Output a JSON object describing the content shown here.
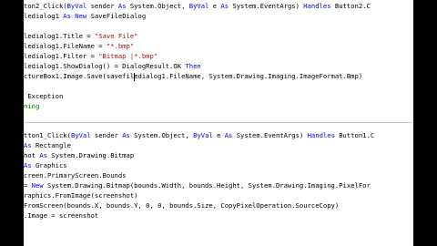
{
  "code": {
    "block1": [
      [
        [
          "ton2_Click(",
          "c"
        ],
        [
          "ByVal",
          "k"
        ],
        [
          " sender ",
          "c"
        ],
        [
          "As",
          "k"
        ],
        [
          " System.Object, ",
          "c"
        ],
        [
          "ByVal",
          "k"
        ],
        [
          " e ",
          "c"
        ],
        [
          "As",
          "k"
        ],
        [
          " System.EventArgs) ",
          "c"
        ],
        [
          "Handles",
          "k"
        ],
        [
          " Button2.C",
          "c"
        ]
      ],
      [
        [
          "ledialog1 ",
          "c"
        ],
        [
          "As New",
          "k"
        ],
        [
          " SaveFileDialog",
          "c"
        ]
      ],
      [
        [
          "",
          "c"
        ]
      ],
      [
        [
          "ledialog1.Title = ",
          "c"
        ],
        [
          "\"Save File\"",
          "s"
        ]
      ],
      [
        [
          "ledialog1.FileName = ",
          "c"
        ],
        [
          "\"*.bmp\"",
          "s"
        ]
      ],
      [
        [
          "ledialog1.Filter = ",
          "c"
        ],
        [
          "\"Bitmap |*.bmp\"",
          "s"
        ]
      ],
      [
        [
          "ledialog1.ShowDialog() = DialogResult.OK ",
          "c"
        ],
        [
          "Then",
          "k"
        ]
      ],
      [
        [
          "ctureBox1.Image.Save(savefiledialog1.FileName, System.Drawing.Imaging.ImageFormat.Bmp)",
          "c"
        ]
      ],
      [
        [
          "",
          "c"
        ]
      ],
      [
        [
          " Exception",
          "c"
        ]
      ],
      [
        [
          "ning",
          "g"
        ]
      ]
    ],
    "block2": [
      [
        [
          "tton1_Click(",
          "c"
        ],
        [
          "ByVal",
          "k"
        ],
        [
          " sender ",
          "c"
        ],
        [
          "As",
          "k"
        ],
        [
          " System.Object, ",
          "c"
        ],
        [
          "ByVal",
          "k"
        ],
        [
          " e ",
          "c"
        ],
        [
          "As",
          "k"
        ],
        [
          " System.EventArgs) ",
          "c"
        ],
        [
          "Handles",
          "k"
        ],
        [
          " Button1.C",
          "c"
        ]
      ],
      [
        [
          "As",
          "k"
        ],
        [
          " Rectangle",
          "c"
        ]
      ],
      [
        [
          "hot ",
          "c"
        ],
        [
          "As",
          "k"
        ],
        [
          " System.Drawing.Bitmap",
          "c"
        ]
      ],
      [
        [
          "As",
          "k"
        ],
        [
          " Graphics",
          "c"
        ]
      ],
      [
        [
          "creen.PrimaryScreen.Bounds",
          "c"
        ]
      ],
      [
        [
          "= ",
          "c"
        ],
        [
          "New",
          "k"
        ],
        [
          " System.Drawing.Bitmap(bounds.Width, bounds.Height, System.Drawing.Imaging.PixelFor",
          "c"
        ]
      ],
      [
        [
          "raphics.FromImage(screenshot)",
          "c"
        ]
      ],
      [
        [
          "FromScreen(bounds.X, bounds.Y, 0, 0, bounds.Size, CopyPixelOperation.SourceCopy)",
          "c"
        ]
      ],
      [
        [
          ".Image = screenshot",
          "c"
        ]
      ]
    ]
  }
}
